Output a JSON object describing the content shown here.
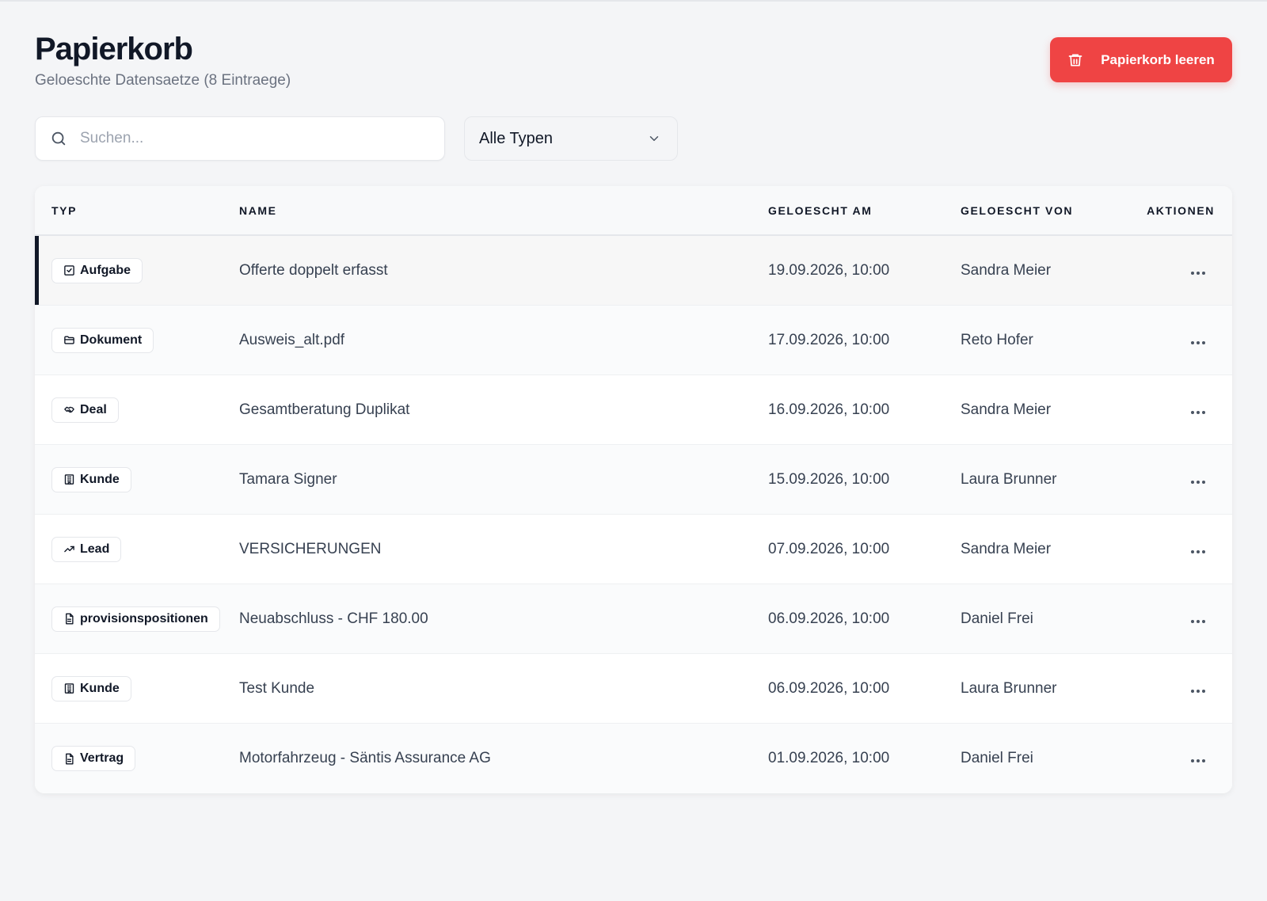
{
  "header": {
    "title": "Papierkorb",
    "subtitle": "Geloeschte Datensaetze (8 Eintraege)",
    "empty_button": "Papierkorb leeren"
  },
  "toolbar": {
    "search_placeholder": "Suchen...",
    "search_value": "",
    "type_filter": "Alle Typen"
  },
  "table": {
    "columns": [
      "TYP",
      "NAME",
      "GELOESCHT AM",
      "GELOESCHT VON",
      "AKTIONEN"
    ],
    "rows": [
      {
        "type": "Aufgabe",
        "icon": "checkbox-icon",
        "name": "Offerte doppelt erfasst",
        "deleted_at": "19.09.2026, 10:00",
        "deleted_by": "Sandra Meier"
      },
      {
        "type": "Dokument",
        "icon": "folder-icon",
        "name": "Ausweis_alt.pdf",
        "deleted_at": "17.09.2026, 10:00",
        "deleted_by": "Reto Hofer"
      },
      {
        "type": "Deal",
        "icon": "handshake-icon",
        "name": "Gesamtberatung Duplikat",
        "deleted_at": "16.09.2026, 10:00",
        "deleted_by": "Sandra Meier"
      },
      {
        "type": "Kunde",
        "icon": "building-icon",
        "name": "Tamara Signer",
        "deleted_at": "15.09.2026, 10:00",
        "deleted_by": "Laura Brunner"
      },
      {
        "type": "Lead",
        "icon": "trending-up-icon",
        "name": "VERSICHERUNGEN",
        "deleted_at": "07.09.2026, 10:00",
        "deleted_by": "Sandra Meier"
      },
      {
        "type": "provisionspositionen",
        "icon": "file-text-icon",
        "name": "Neuabschluss - CHF 180.00",
        "deleted_at": "06.09.2026, 10:00",
        "deleted_by": "Daniel Frei"
      },
      {
        "type": "Kunde",
        "icon": "building-icon",
        "name": "Test Kunde",
        "deleted_at": "06.09.2026, 10:00",
        "deleted_by": "Laura Brunner"
      },
      {
        "type": "Vertrag",
        "icon": "file-text-icon",
        "name": "Motorfahrzeug - Säntis Assurance AG",
        "deleted_at": "01.09.2026, 10:00",
        "deleted_by": "Daniel Frei"
      }
    ]
  },
  "colors": {
    "accent_danger": "#ef4444",
    "background": "#f4f5f7",
    "text_primary": "#111827",
    "text_muted": "#6b7280"
  }
}
